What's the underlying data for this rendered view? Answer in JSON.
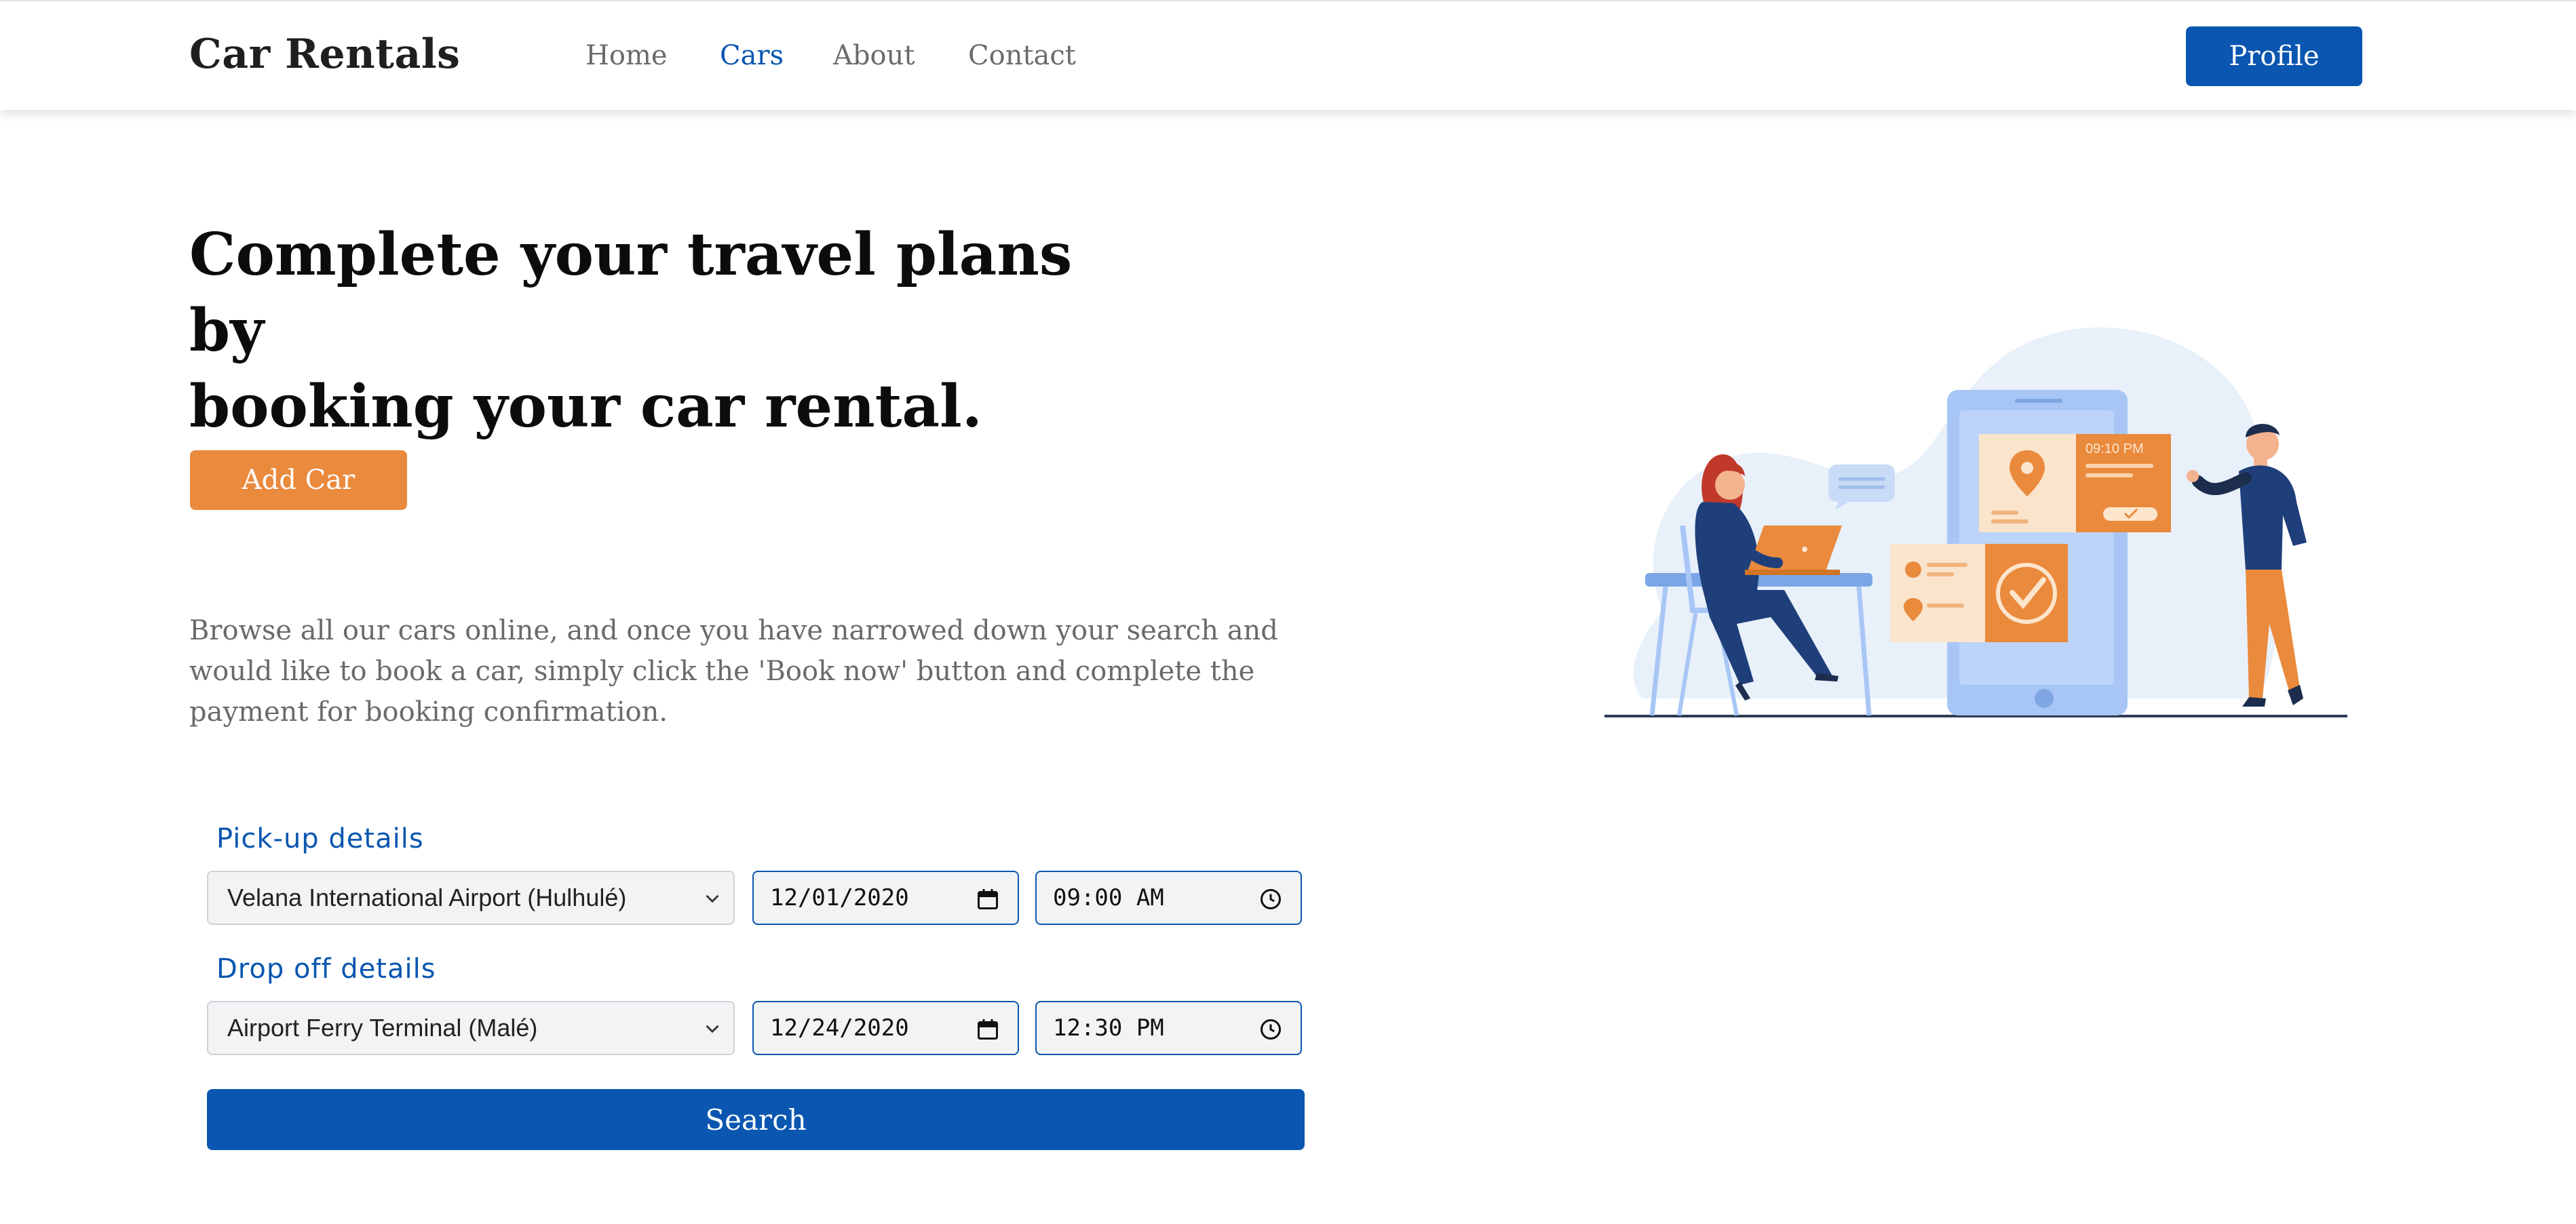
{
  "navbar": {
    "brand": "Car Rentals",
    "links": [
      {
        "label": "Home",
        "active": false
      },
      {
        "label": "Cars",
        "active": true
      },
      {
        "label": "About",
        "active": false
      },
      {
        "label": "Contact",
        "active": false
      }
    ],
    "profile_label": "Profile"
  },
  "hero": {
    "headline_line1": "Complete your travel plans by",
    "headline_line2": "booking your car rental.",
    "add_car_label": "Add Car",
    "intro_text": "Browse all our cars online, and once you have narrowed down your search and would like to book a car, simply click the 'Book now' button and complete the payment for booking confirmation."
  },
  "booking": {
    "pickup": {
      "label": "Pick-up details",
      "location": "Velana International Airport (Hulhulé)",
      "date": "12/01/2020",
      "time": "09:00 AM"
    },
    "dropoff": {
      "label": "Drop off details",
      "location": "Airport Ferry Terminal (Malé)",
      "date": "12/24/2020",
      "time": "12:30 PM"
    },
    "search_label": "Search"
  },
  "illustration": {
    "card_time": "09:10 PM"
  },
  "colors": {
    "primary": "#0a56b0",
    "accent": "#ea8a3d",
    "text_muted": "#6a6a6a"
  },
  "icons": {
    "select_arrow": "chevron-down-icon",
    "date_picker": "calendar-icon",
    "time_picker": "clock-icon"
  }
}
